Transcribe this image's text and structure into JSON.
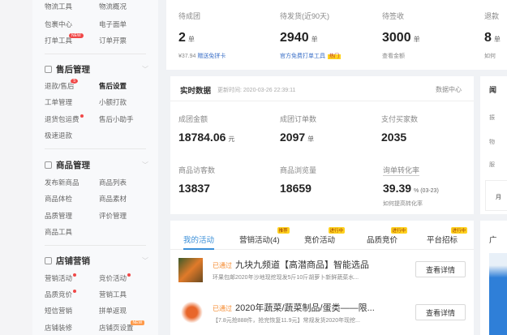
{
  "sidebar": {
    "rows_top": [
      [
        "物流工具",
        "物流概况"
      ],
      [
        "包裹中心",
        "电子面单"
      ],
      [
        "打单工具",
        "订单开票"
      ]
    ],
    "top_badge": "NEW",
    "sections": [
      {
        "title": "售后管理",
        "rows": [
          [
            "退款/售后",
            "售后设置"
          ],
          [
            "工单管理",
            "小额打款"
          ],
          [
            "退货包运费",
            "售后小助手"
          ],
          [
            "极速退款",
            ""
          ]
        ],
        "badge": "5"
      },
      {
        "title": "商品管理",
        "rows": [
          [
            "发布新商品",
            "商品列表"
          ],
          [
            "商品体检",
            "商品素材"
          ],
          [
            "品质管理",
            "评价管理"
          ],
          [
            "商品工具",
            ""
          ]
        ]
      },
      {
        "title": "店铺营销",
        "rows": [
          [
            "营销活动",
            "竞价活动"
          ],
          [
            "品质竞价",
            "营销工具"
          ],
          [
            "短信营销",
            "拼单返现"
          ],
          [
            "店铺装修",
            "店铺页设置"
          ]
        ],
        "badge": "NEW"
      }
    ]
  },
  "stats": [
    {
      "label": "待成团",
      "value": "2",
      "unit": "单",
      "sub_prefix": "¥37.94",
      "sub_link": "赠送免拼卡"
    },
    {
      "label": "待发货(近90天)",
      "value": "2940",
      "unit": "单",
      "sub_link": "官方免费打单工具",
      "hot": "热门"
    },
    {
      "label": "待签收",
      "value": "3000",
      "unit": "单",
      "sub_link": "查看金额"
    },
    {
      "label": "退款",
      "value": "8",
      "unit": "单",
      "sub_link": "如何"
    }
  ],
  "realtime": {
    "title": "实时数据",
    "update": "更新时间: 2020-03-26 22:39:11",
    "link": "数据中心",
    "metrics": [
      {
        "label": "成团金额",
        "value": "18784.06",
        "unit": "元"
      },
      {
        "label": "成团订单数",
        "value": "2097",
        "unit": "单"
      },
      {
        "label": "支付买家数",
        "value": "2035",
        "unit": ""
      },
      {
        "label": "商品访客数",
        "value": "13837",
        "unit": ""
      },
      {
        "label": "商品浏览量",
        "value": "18659",
        "unit": ""
      },
      {
        "label": "询单转化率",
        "value": "39.39",
        "unit": "% (03-23)",
        "link": "如何提高转化率"
      }
    ]
  },
  "right_panel": {
    "title": "闻",
    "items": [
      "振",
      "物",
      "服",
      "月"
    ],
    "ad_title": "广"
  },
  "activities": {
    "tabs": [
      {
        "label": "我的活动"
      },
      {
        "label": "营销活动(4)",
        "tag": "推荐"
      },
      {
        "label": "竞价活动",
        "tag": "进行中"
      },
      {
        "label": "品质竞价",
        "tag": "进行中"
      },
      {
        "label": "平台招标",
        "tag": "进行中"
      }
    ],
    "items": [
      {
        "status": "已通过",
        "title": "九块九频道【高潜商品】智能选品",
        "desc": "环果包邮2020年沙地现挖现发5斤10斤胡萝卜新鲜蔬菜水...",
        "button": "查看详情"
      },
      {
        "status": "已通过",
        "title": "2020年蔬菜/蔬菜制品/蛋类——限...",
        "desc": "【7.8元抢888件，抢完恢复11.9元】常规发货2020年现挖...",
        "button": "查看详情"
      }
    ]
  }
}
